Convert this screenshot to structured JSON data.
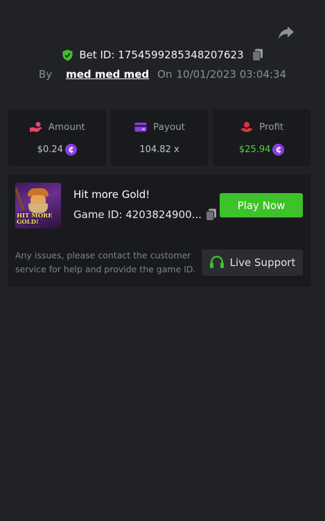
{
  "header": {
    "bet_id_label": "Bet ID: 1754599285348207623",
    "by_label": "By",
    "username": "med med med",
    "on_label": "On",
    "datetime": "10/01/2023 03:04:34"
  },
  "stats": {
    "amount": {
      "label": "Amount",
      "value": "$0.24",
      "coin_symbol": "₵"
    },
    "payout": {
      "label": "Payout",
      "value": "104.82 x"
    },
    "profit": {
      "label": "Profit",
      "value": "$25.94",
      "coin_symbol": "₵"
    }
  },
  "game": {
    "title": "Hit more Gold!",
    "game_id_label": "Game ID: 4203824900...",
    "thumb_logo_text": "HIT MORE GOLD!",
    "play_label": "Play Now"
  },
  "support": {
    "help_text": "Any issues, please contact the customer service for help and provide the game ID.",
    "button_label": "Live Support"
  },
  "colors": {
    "background": "#212226",
    "card": "#191a1e",
    "accent_green": "#3ec22a",
    "profit_green": "#53d33b",
    "coin_purple": "#8a3fe0"
  },
  "icons": {
    "share": "share-icon",
    "verified": "shield-check-icon",
    "copy": "copy-icon",
    "amount": "hand-coins-icon",
    "payout": "wallet-card-icon",
    "profit": "hand-money-icon",
    "support": "headset-icon"
  }
}
